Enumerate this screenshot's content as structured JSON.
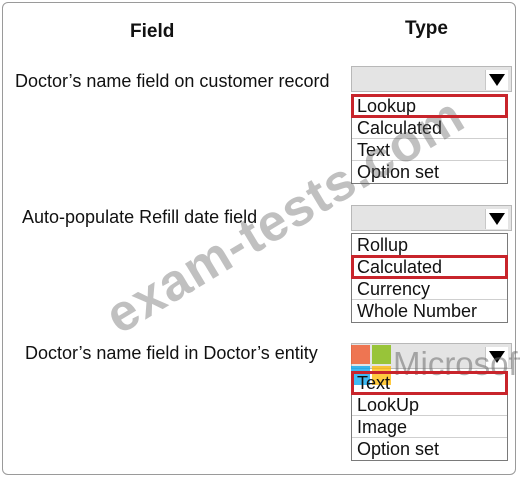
{
  "headers": {
    "field": "Field",
    "type": "Type"
  },
  "rows": [
    {
      "label": "Doctor’s name field on customer record",
      "options": [
        "Lookup",
        "Calculated",
        "Text",
        "Option set"
      ],
      "selected_index": 0
    },
    {
      "label": "Auto-populate Refill date field",
      "options": [
        "Rollup",
        "Calculated",
        "Currency",
        "Whole Number"
      ],
      "selected_index": 1
    },
    {
      "label": "Doctor’s name field in Doctor’s entity",
      "options": [
        "Text",
        "LookUp",
        "Image",
        "Option set"
      ],
      "selected_index": 0
    }
  ],
  "watermark": {
    "text": "exam-tests.com",
    "brand": "Microsoft"
  },
  "colors": {
    "selection_outline": "#c8242b",
    "dropdown_header": "#e4e4e4"
  },
  "icons": {
    "dropdown_arrow": "triangle-down",
    "brand_logo": "four-square-logo"
  }
}
